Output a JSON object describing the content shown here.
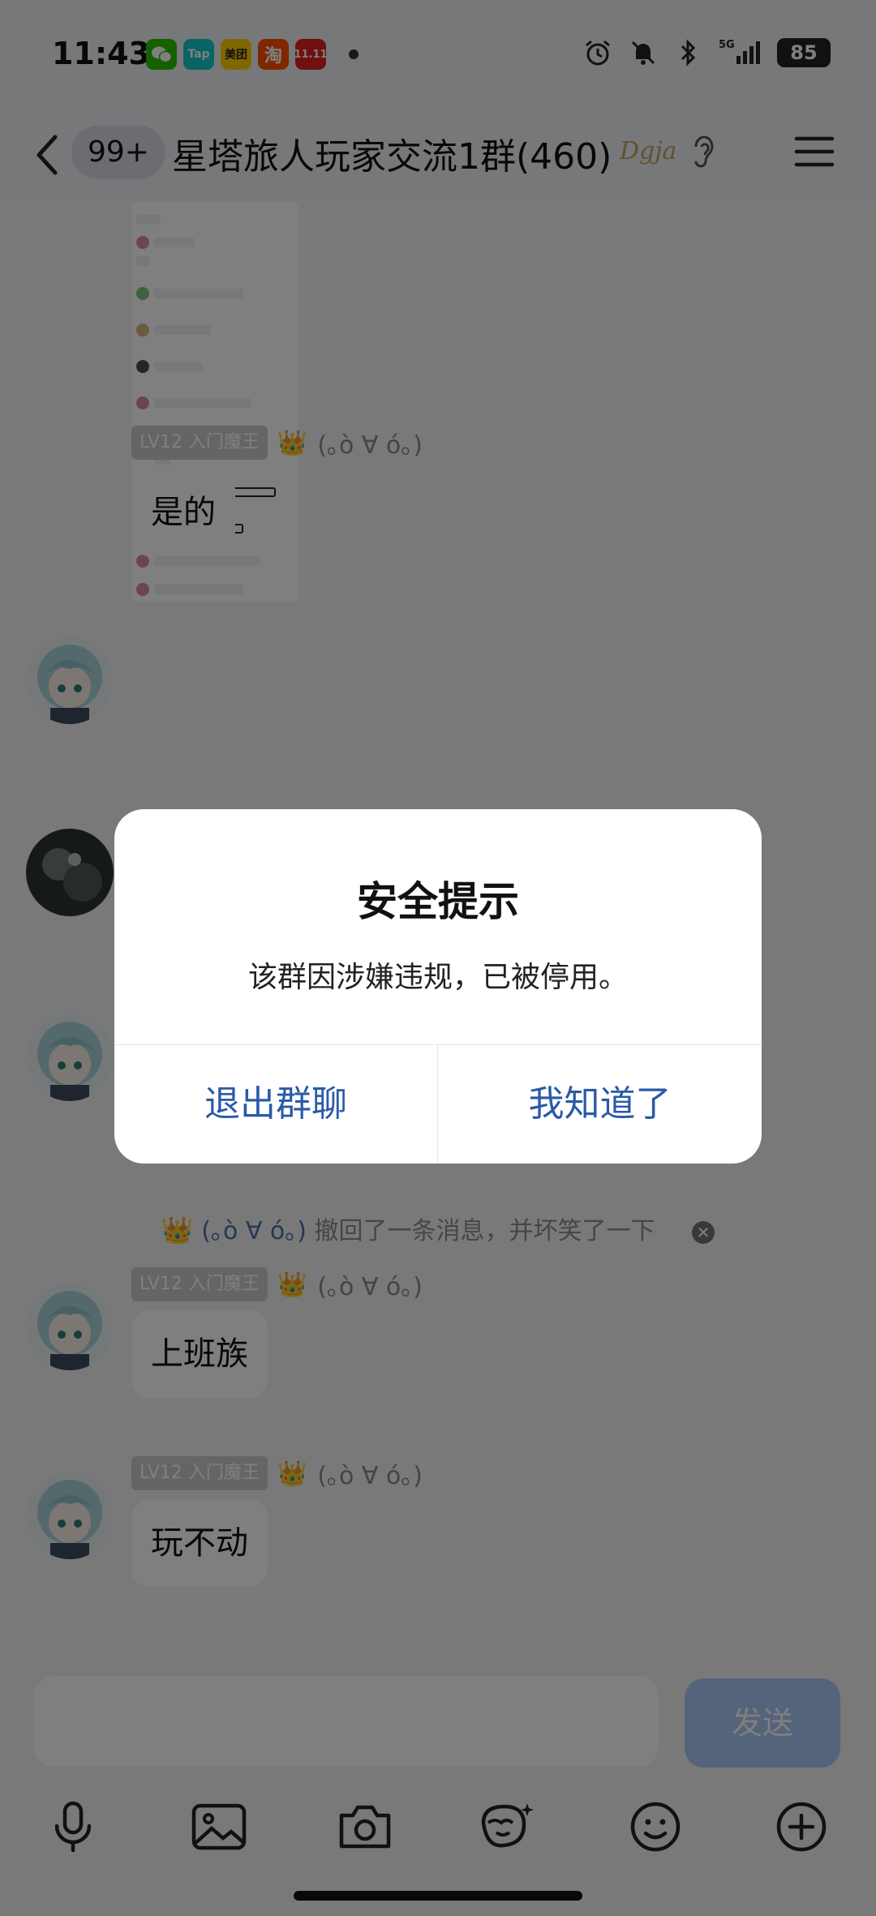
{
  "status_bar": {
    "time": "11:43",
    "apps": [
      {
        "name": "wechat-icon",
        "label": "",
        "color": "#2dc100"
      },
      {
        "name": "taptap-icon",
        "label": "Tap",
        "color": "#14c9c9"
      },
      {
        "name": "meituan-icon",
        "label": "美团",
        "color": "#ffd100"
      },
      {
        "name": "taobao-icon",
        "label": "淘",
        "color": "#ff5000"
      },
      {
        "name": "tmall-icon",
        "label": "11.11",
        "color": "#e0201f"
      }
    ],
    "network": "5G",
    "battery": "85"
  },
  "header": {
    "unread_count": "99+",
    "title": "星塔旅人玩家交流1群(460)",
    "badge": "Dgja"
  },
  "messages": [
    {
      "tag": "LV12 入门魔王",
      "nick": "(｡ò ∀ ó｡)",
      "text": "是的"
    },
    {
      "tag": "LV12 入门魔王",
      "nick": "(｡ò ∀ ó｡)",
      "text": "上班族"
    },
    {
      "tag": "LV12 入门魔王",
      "nick": "(｡ò ∀ ó｡)",
      "text": "玩不动"
    }
  ],
  "recall_notice": {
    "nick": "(｡ò ∀ ó｡)",
    "text": "撤回了一条消息，并坏笑了一下"
  },
  "input": {
    "send_label": "发送"
  },
  "dialog": {
    "title": "安全提示",
    "message": "该群因涉嫌违规，已被停用。",
    "left_button": "退出群聊",
    "right_button": "我知道了"
  },
  "colors": {
    "accent": "#2a5aa8",
    "send_disabled": "#a9c8f5",
    "overlay": "rgba(0,0,0,0.5)"
  }
}
